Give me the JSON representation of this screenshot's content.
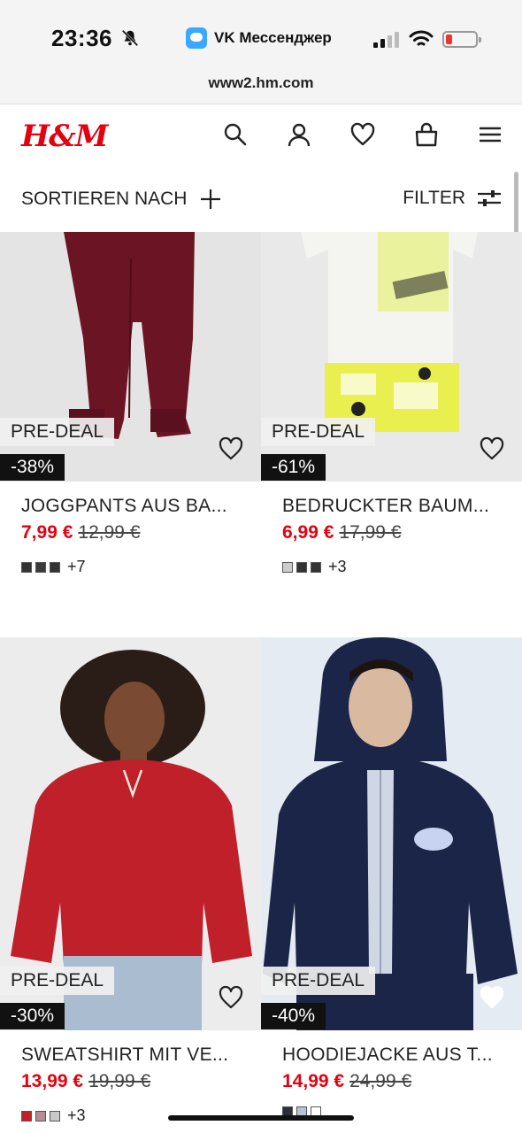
{
  "status": {
    "time": "23:36",
    "app_label": "VK Мессенджер"
  },
  "url": "www2.hm.com",
  "header": {
    "logo": "H&M"
  },
  "toolbar": {
    "sort_label": "SORTIEREN NACH",
    "filter_label": "FILTER"
  },
  "colors": {
    "brand_red": "#e50010",
    "discount_bg": "#111111"
  },
  "products": [
    {
      "title": "JOGGPANTS AUS BA...",
      "badge": "PRE-DEAL",
      "discount": "-38%",
      "price_new": "7,99 €",
      "price_old": "12,99 €",
      "swatches": [
        "#333333",
        "#3a3a3a",
        "#333333"
      ],
      "more": "+7"
    },
    {
      "title": "BEDRUCKTER BAUM...",
      "badge": "PRE-DEAL",
      "discount": "-61%",
      "price_new": "6,99 €",
      "price_old": "17,99 €",
      "swatches": [
        "#cccccc",
        "#333333",
        "#333333"
      ],
      "more": "+3"
    },
    {
      "title": "SWEATSHIRT MIT VE...",
      "badge": "PRE-DEAL",
      "discount": "-30%",
      "price_new": "13,99 €",
      "price_old": "19,99 €",
      "swatches": [
        "#c0202a",
        "#b98b96",
        "#c9c9c9"
      ],
      "more": "+3"
    },
    {
      "title": "HOODIEJACKE AUS T...",
      "badge": "PRE-DEAL",
      "discount": "-40%",
      "price_new": "14,99 €",
      "price_old": "24,99 €",
      "swatches": [
        "#2b2f3a",
        "#b9c3d3",
        "#ffffff"
      ],
      "more": ""
    }
  ]
}
